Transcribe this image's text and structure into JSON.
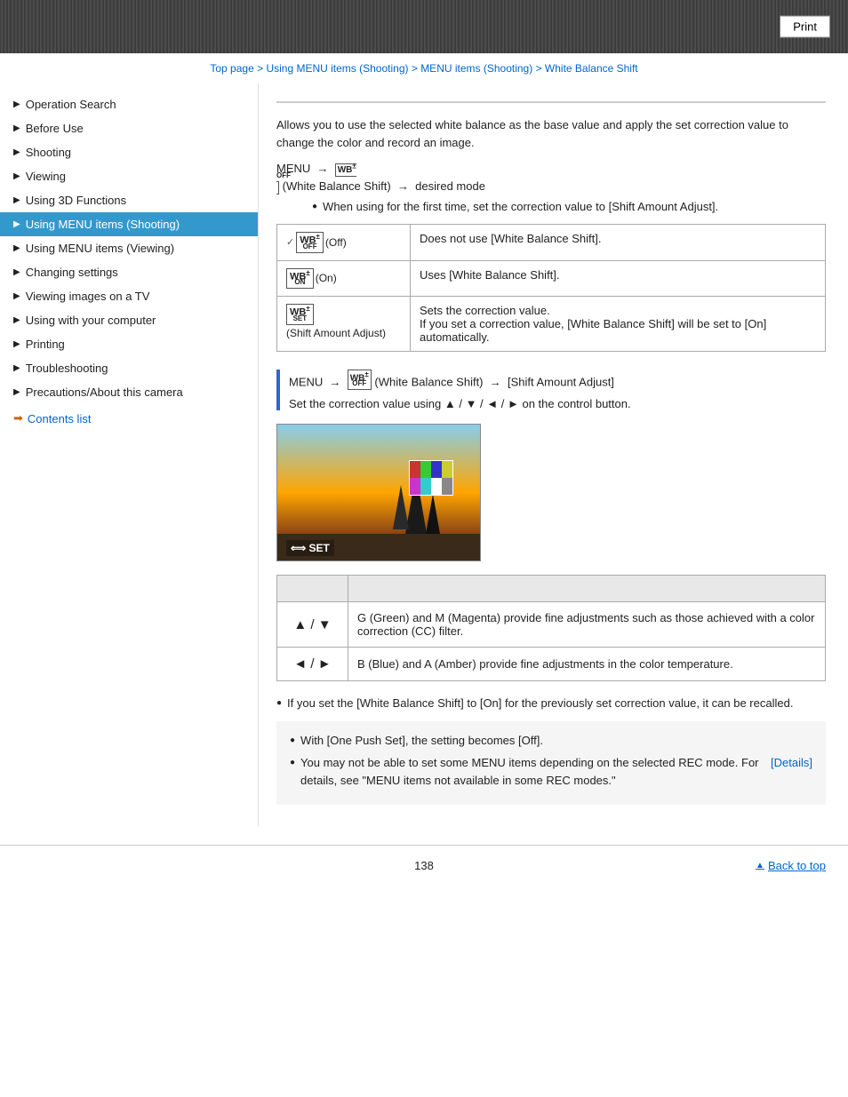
{
  "header": {
    "print_label": "Print"
  },
  "breadcrumb": {
    "items": [
      {
        "label": "Top page",
        "href": "#"
      },
      {
        "label": "Using MENU items (Shooting)",
        "href": "#"
      },
      {
        "label": "MENU items (Shooting)",
        "href": "#"
      },
      {
        "label": "White Balance Shift",
        "href": "#"
      }
    ],
    "separator": " > "
  },
  "sidebar": {
    "items": [
      {
        "label": "Operation Search",
        "active": false
      },
      {
        "label": "Before Use",
        "active": false
      },
      {
        "label": "Shooting",
        "active": false
      },
      {
        "label": "Viewing",
        "active": false
      },
      {
        "label": "Using 3D Functions",
        "active": false
      },
      {
        "label": "Using MENU items (Shooting)",
        "active": true
      },
      {
        "label": "Using MENU items (Viewing)",
        "active": false
      },
      {
        "label": "Changing settings",
        "active": false
      },
      {
        "label": "Viewing images on a TV",
        "active": false
      },
      {
        "label": "Using with your computer",
        "active": false
      },
      {
        "label": "Printing",
        "active": false
      },
      {
        "label": "Troubleshooting",
        "active": false
      },
      {
        "label": "Precautions/About this camera",
        "active": false
      }
    ],
    "contents_link": "Contents list"
  },
  "content": {
    "description": "Allows you to use the selected white balance as the base value and apply the set correction value to change the color and record an image.",
    "menu_path": "MENU → (White Balance Shift) → desired mode",
    "first_bullet": "When using for the first time, set the correction value to [Shift Amount Adjust].",
    "table": {
      "rows": [
        {
          "icon_label": "WB± OFF (Off)",
          "description": "Does not use [White Balance Shift]."
        },
        {
          "icon_label": "WB± ON (On)",
          "description": "Uses [White Balance Shift]."
        },
        {
          "icon_label": "WB± SET (Shift Amount Adjust)",
          "description": "Sets the correction value.\nIf you set a correction value, [White Balance Shift] will be set to [On] automatically."
        }
      ]
    },
    "section2_menu_path": "MENU → (White Balance Shift) → [Shift Amount Adjust]",
    "section2_text": "Set the correction value using ▲ / ▼ / ◄ / ► on the control button.",
    "image_label": "⟺ SET",
    "second_table": {
      "header": [
        "",
        ""
      ],
      "rows": [
        {
          "key": "▲ / ▼",
          "value": "G (Green) and M (Magenta) provide fine adjustments such as those achieved with a color correction (CC) filter."
        },
        {
          "key": "◄ / ►",
          "value": "B (Blue) and A (Amber) provide fine adjustments in the color temperature."
        }
      ]
    },
    "recall_note": "If you set the [White Balance Shift] to [On] for the previously set correction value, it can be recalled.",
    "note_box": {
      "lines": [
        "With [One Push Set], the setting becomes [Off].",
        "You may not be able to set some MENU items depending on the selected REC mode. For details, see \"MENU items not available in some REC modes.\" [Details]"
      ]
    },
    "details_link": "[Details]",
    "page_number": "138"
  },
  "footer": {
    "back_to_top": "Back to top"
  }
}
